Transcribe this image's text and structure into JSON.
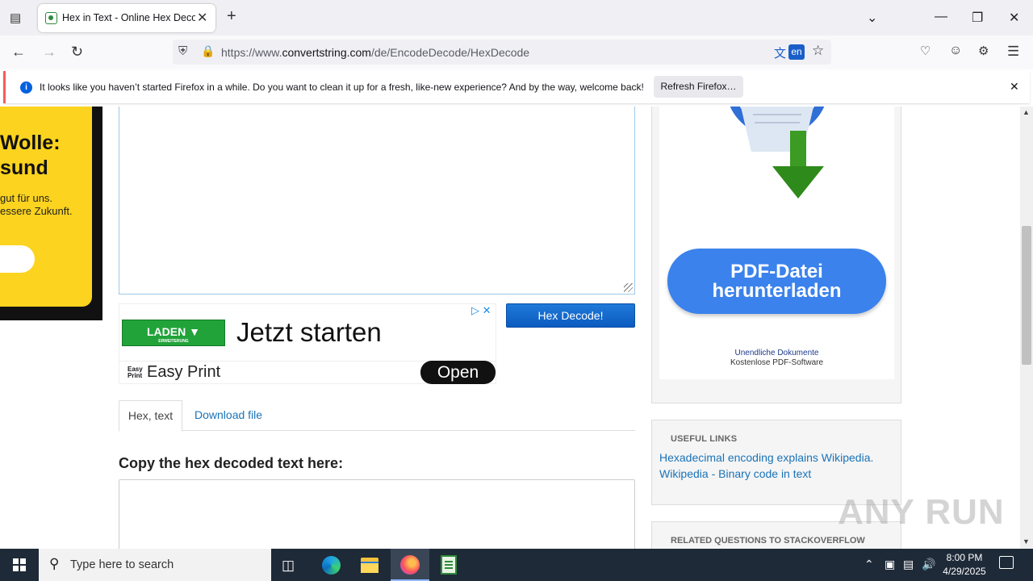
{
  "browser": {
    "tab_title": "Hex in Text - Online Hex Decoder",
    "new_tab_symbol": "+",
    "url_prefix": "https://www.",
    "url_domain": "convertstring.com",
    "url_path": "/de/EncodeDecode/HexDecode",
    "translate_lang": "en"
  },
  "notification": {
    "message": "It looks like you haven’t started Firefox in a while. Do you want to clean it up for a fresh, like-new experience? And by the way, welcome back!",
    "button": "Refresh Firefox…"
  },
  "left_ad": {
    "headline_1": "Wolle:",
    "headline_2": "sund",
    "body_1": "gut für uns.",
    "body_2": "essere Zukunft."
  },
  "main": {
    "decode_button": "Hex Decode!",
    "tabs": [
      {
        "label": "Hex, text"
      },
      {
        "label": "Download file"
      }
    ],
    "output_heading": "Copy the hex decoded text here:"
  },
  "banner_ad": {
    "cta_label": "LADEN",
    "cta_sub": "ERWEITERUNG",
    "headline": "Jetzt starten",
    "brand_icon_1": "Easy",
    "brand_icon_2": "Print",
    "brand": "Easy Print",
    "open_button": "Open"
  },
  "right_ad": {
    "button_line_1": "PDF-Datei",
    "button_line_2": "herunterladen",
    "sub_1": "Unendliche Dokumente",
    "sub_2": "Kostenlose PDF-Software"
  },
  "sidebar": {
    "useful_links_heading": "USEFUL LINKS",
    "links": [
      {
        "label": "Hexadecimal encoding explains Wikipedia."
      },
      {
        "label": "Wikipedia - Binary code in text"
      }
    ],
    "related_heading": "RELATED QUESTIONS TO STACKOVERFLOW"
  },
  "watermark": "ANY RUN",
  "taskbar": {
    "search_placeholder": "Type here to search",
    "time": "8:00 PM",
    "date": "4/29/2025"
  }
}
